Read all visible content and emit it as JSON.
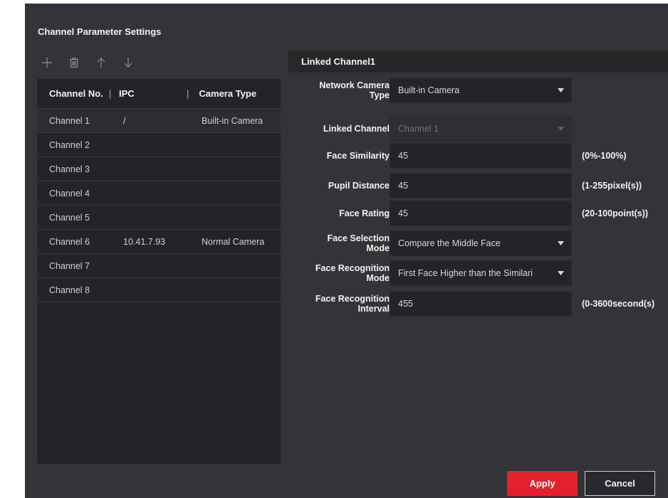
{
  "page": {
    "title": "Channel Parameter Settings"
  },
  "toolbar": {
    "icons": [
      "add-icon",
      "delete-icon",
      "move-up-icon",
      "move-down-icon"
    ]
  },
  "table": {
    "headers": {
      "channel": "Channel No.",
      "ipc": "IPC",
      "camera_type": "Camera Type",
      "separator": "|"
    },
    "rows": [
      {
        "channel": "Channel 1",
        "ipc": "/",
        "camera_type": "Built-in Camera",
        "selected": true
      },
      {
        "channel": "Channel 2",
        "ipc": "",
        "camera_type": ""
      },
      {
        "channel": "Channel 3",
        "ipc": "",
        "camera_type": ""
      },
      {
        "channel": "Channel 4",
        "ipc": "",
        "camera_type": ""
      },
      {
        "channel": "Channel 5",
        "ipc": "",
        "camera_type": ""
      },
      {
        "channel": "Channel 6",
        "ipc": "10.41.7.93",
        "camera_type": "Normal Camera"
      },
      {
        "channel": "Channel 7",
        "ipc": "",
        "camera_type": ""
      },
      {
        "channel": "Channel 8",
        "ipc": "",
        "camera_type": ""
      }
    ]
  },
  "settings": {
    "header": "Linked Channel1",
    "network_camera_type": {
      "label_line1": "Network Camera",
      "label_line2": "Type",
      "value": "Built-in Camera"
    },
    "linked_channel": {
      "label": "Linked Channel",
      "value": "Channel 1"
    },
    "face_similarity": {
      "label": "Face Similarity",
      "value": "45",
      "range": "(0%-100%)"
    },
    "pupil_distance": {
      "label": "Pupil Distance",
      "value": "45",
      "range": "(1-255pixel(s))"
    },
    "face_rating": {
      "label": "Face Rating",
      "value": "45",
      "range": "(20-100point(s))"
    },
    "face_selection_mode": {
      "label_line1": "Face Selection",
      "label_line2": "Mode",
      "value": "Compare the Middle Face"
    },
    "face_recognition_mode": {
      "label_line1": "Face Recognition",
      "label_line2": "Mode",
      "value": "First Face Higher than the Similari"
    },
    "face_recognition_interval": {
      "label_line1": "Face Recognition",
      "label_line2": "Interval",
      "value": "455",
      "range": "(0-3600second(s)"
    }
  },
  "buttons": {
    "apply": "Apply",
    "cancel": "Cancel"
  },
  "colors": {
    "panel_bg": "#333437",
    "accent": "#e4202d"
  }
}
